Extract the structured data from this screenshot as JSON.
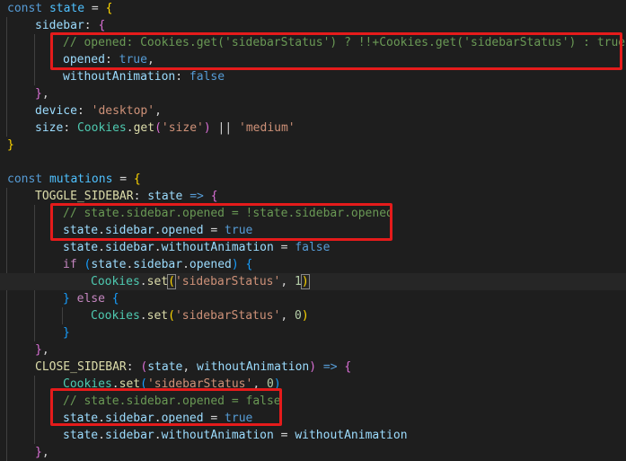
{
  "editor": {
    "lines": [
      {
        "indent": 0,
        "tokens": [
          [
            "kw",
            "const "
          ],
          [
            "con",
            "state"
          ],
          [
            "op",
            " = "
          ],
          [
            "b1",
            "{"
          ]
        ]
      },
      {
        "indent": 1,
        "tokens": [
          [
            "var",
            "sidebar"
          ],
          [
            "op",
            ": "
          ],
          [
            "b2",
            "{"
          ]
        ]
      },
      {
        "indent": 2,
        "tokens": [
          [
            "cmt",
            "// opened: Cookies.get('sidebarStatus') ? !!+Cookies.get('sidebarStatus') : true,"
          ]
        ]
      },
      {
        "indent": 2,
        "tokens": [
          [
            "var",
            "opened"
          ],
          [
            "op",
            ": "
          ],
          [
            "kw",
            "true"
          ],
          [
            "op",
            ","
          ]
        ]
      },
      {
        "indent": 2,
        "tokens": [
          [
            "var",
            "withoutAnimation"
          ],
          [
            "op",
            ": "
          ],
          [
            "kw",
            "false"
          ]
        ]
      },
      {
        "indent": 1,
        "tokens": [
          [
            "b2",
            "}"
          ],
          [
            "op",
            ","
          ]
        ]
      },
      {
        "indent": 1,
        "tokens": [
          [
            "var",
            "device"
          ],
          [
            "op",
            ": "
          ],
          [
            "str",
            "'desktop'"
          ],
          [
            "op",
            ","
          ]
        ]
      },
      {
        "indent": 1,
        "tokens": [
          [
            "var",
            "size"
          ],
          [
            "op",
            ": "
          ],
          [
            "cls",
            "Cookies"
          ],
          [
            "op",
            "."
          ],
          [
            "fn",
            "get"
          ],
          [
            "b2",
            "("
          ],
          [
            "str",
            "'size'"
          ],
          [
            "b2",
            ")"
          ],
          [
            "op",
            " || "
          ],
          [
            "str",
            "'medium'"
          ]
        ]
      },
      {
        "indent": 0,
        "tokens": [
          [
            "b1",
            "}"
          ]
        ]
      },
      {
        "indent": 0,
        "tokens": []
      },
      {
        "indent": 0,
        "tokens": [
          [
            "kw",
            "const "
          ],
          [
            "con",
            "mutations"
          ],
          [
            "op",
            " = "
          ],
          [
            "b1",
            "{"
          ]
        ]
      },
      {
        "indent": 1,
        "tokens": [
          [
            "fn",
            "TOGGLE_SIDEBAR"
          ],
          [
            "op",
            ": "
          ],
          [
            "var",
            "state"
          ],
          [
            "op",
            " "
          ],
          [
            "kw",
            "=>"
          ],
          [
            "op",
            " "
          ],
          [
            "b2",
            "{"
          ]
        ]
      },
      {
        "indent": 2,
        "tokens": [
          [
            "cmt",
            "// state.sidebar.opened = !state.sidebar.opened"
          ]
        ]
      },
      {
        "indent": 2,
        "tokens": [
          [
            "var",
            "state"
          ],
          [
            "op",
            "."
          ],
          [
            "var",
            "sidebar"
          ],
          [
            "op",
            "."
          ],
          [
            "var",
            "opened"
          ],
          [
            "op",
            " = "
          ],
          [
            "kw",
            "true"
          ]
        ]
      },
      {
        "indent": 2,
        "tokens": [
          [
            "var",
            "state"
          ],
          [
            "op",
            "."
          ],
          [
            "var",
            "sidebar"
          ],
          [
            "op",
            "."
          ],
          [
            "var",
            "withoutAnimation"
          ],
          [
            "op",
            " = "
          ],
          [
            "kw",
            "false"
          ]
        ]
      },
      {
        "indent": 2,
        "tokens": [
          [
            "ctl",
            "if"
          ],
          [
            "op",
            " "
          ],
          [
            "b3",
            "("
          ],
          [
            "var",
            "state"
          ],
          [
            "op",
            "."
          ],
          [
            "var",
            "sidebar"
          ],
          [
            "op",
            "."
          ],
          [
            "var",
            "opened"
          ],
          [
            "b3",
            ")"
          ],
          [
            "op",
            " "
          ],
          [
            "b3",
            "{"
          ]
        ]
      },
      {
        "indent": 3,
        "current": true,
        "tokens": [
          [
            "cls",
            "Cookies"
          ],
          [
            "op",
            "."
          ],
          [
            "fn",
            "set"
          ],
          [
            "b1m",
            "("
          ],
          [
            "str",
            "'sidebarStatus'"
          ],
          [
            "op",
            ", "
          ],
          [
            "num",
            "1"
          ],
          [
            "b1m",
            ")"
          ]
        ]
      },
      {
        "indent": 2,
        "tokens": [
          [
            "b3",
            "}"
          ],
          [
            "op",
            " "
          ],
          [
            "ctl",
            "else"
          ],
          [
            "op",
            " "
          ],
          [
            "b3",
            "{"
          ]
        ]
      },
      {
        "indent": 3,
        "tokens": [
          [
            "cls",
            "Cookies"
          ],
          [
            "op",
            "."
          ],
          [
            "fn",
            "set"
          ],
          [
            "b1",
            "("
          ],
          [
            "str",
            "'sidebarStatus'"
          ],
          [
            "op",
            ", "
          ],
          [
            "num",
            "0"
          ],
          [
            "b1",
            ")"
          ]
        ]
      },
      {
        "indent": 2,
        "tokens": [
          [
            "b3",
            "}"
          ]
        ]
      },
      {
        "indent": 1,
        "tokens": [
          [
            "b2",
            "}"
          ],
          [
            "op",
            ","
          ]
        ]
      },
      {
        "indent": 1,
        "tokens": [
          [
            "fn",
            "CLOSE_SIDEBAR"
          ],
          [
            "op",
            ": "
          ],
          [
            "b2",
            "("
          ],
          [
            "var",
            "state"
          ],
          [
            "op",
            ", "
          ],
          [
            "var",
            "withoutAnimation"
          ],
          [
            "b2",
            ")"
          ],
          [
            "op",
            " "
          ],
          [
            "kw",
            "=>"
          ],
          [
            "op",
            " "
          ],
          [
            "b2",
            "{"
          ]
        ]
      },
      {
        "indent": 2,
        "tokens": [
          [
            "cls",
            "Cookies"
          ],
          [
            "op",
            "."
          ],
          [
            "fn",
            "set"
          ],
          [
            "b3",
            "("
          ],
          [
            "str",
            "'sidebarStatus'"
          ],
          [
            "op",
            ", "
          ],
          [
            "num",
            "0"
          ],
          [
            "b3",
            ")"
          ]
        ]
      },
      {
        "indent": 2,
        "tokens": [
          [
            "cmt",
            "// state.sidebar.opened = false"
          ]
        ]
      },
      {
        "indent": 2,
        "tokens": [
          [
            "var",
            "state"
          ],
          [
            "op",
            "."
          ],
          [
            "var",
            "sidebar"
          ],
          [
            "op",
            "."
          ],
          [
            "var",
            "opened"
          ],
          [
            "op",
            " = "
          ],
          [
            "kw",
            "true"
          ]
        ]
      },
      {
        "indent": 2,
        "tokens": [
          [
            "var",
            "state"
          ],
          [
            "op",
            "."
          ],
          [
            "var",
            "sidebar"
          ],
          [
            "op",
            "."
          ],
          [
            "var",
            "withoutAnimation"
          ],
          [
            "op",
            " = "
          ],
          [
            "var",
            "withoutAnimation"
          ]
        ]
      },
      {
        "indent": 1,
        "tokens": [
          [
            "b2",
            "}"
          ],
          [
            "op",
            ","
          ]
        ]
      }
    ],
    "highlight_color": "#e51b1b",
    "background_color": "#1e1e1e"
  }
}
